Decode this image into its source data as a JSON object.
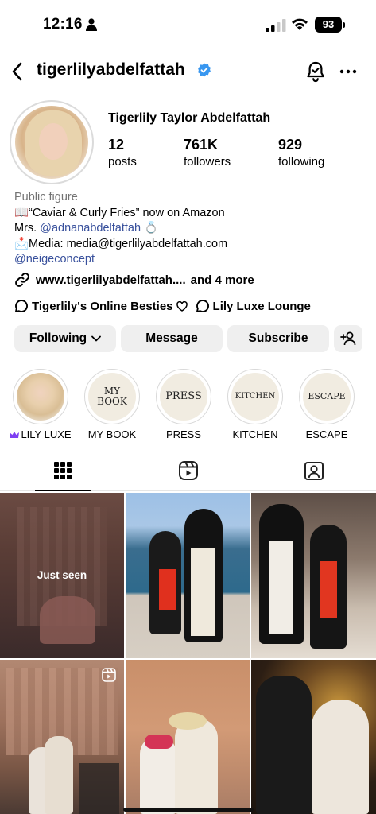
{
  "status_bar": {
    "time": "12:16",
    "battery": "93"
  },
  "header": {
    "username": "tigerlilyabdelfattah"
  },
  "profile": {
    "full_name": "Tigerlily Taylor Abdelfattah",
    "stats": [
      {
        "value": "12",
        "label": "posts"
      },
      {
        "value": "761K",
        "label": "followers"
      },
      {
        "value": "929",
        "label": "following"
      }
    ],
    "category": "Public figure",
    "bio_line1": "📖“Caviar & Curly Fries” now on Amazon",
    "bio_line2_prefix": "Mrs. ",
    "bio_line2_mention": "@adnanabdelfattah",
    "bio_line2_suffix": " 💍",
    "bio_line3": "📩Media: media@tigerlilyabdelfattah.com",
    "bio_line4": "@neigeconcept",
    "website": "www.tigerlilyabdelfattah....",
    "more_links": "and 4 more",
    "channel1": "Tigerlily's Online Besties",
    "channel2": "Lily Luxe Lounge"
  },
  "buttons": {
    "following": "Following",
    "message": "Message",
    "subscribe": "Subscribe"
  },
  "highlights": [
    {
      "label": "LILY LUXE",
      "cover_text": ""
    },
    {
      "label": "MY BOOK",
      "cover_text": "MY\nBOOK"
    },
    {
      "label": "PRESS",
      "cover_text": "PRESS"
    },
    {
      "label": "KITCHEN",
      "cover_text": "KITCHEN"
    },
    {
      "label": "ESCAPE",
      "cover_text": "ESCAPE"
    }
  ],
  "grid": {
    "just_seen": "Just seen"
  },
  "colors": {
    "link": "#38509c",
    "verified": "#3897f0",
    "button_bg": "#efefef",
    "lily_luxe_crown": "#7e3ff2"
  },
  "icons": [
    "back-chevron-icon",
    "verified-badge-icon",
    "notification-bell-icon",
    "more-options-icon",
    "link-chain-icon",
    "broadcast-channel-icon",
    "heart-icon",
    "add-person-icon",
    "grid-icon",
    "reels-icon",
    "tagged-icon",
    "crown-icon"
  ]
}
